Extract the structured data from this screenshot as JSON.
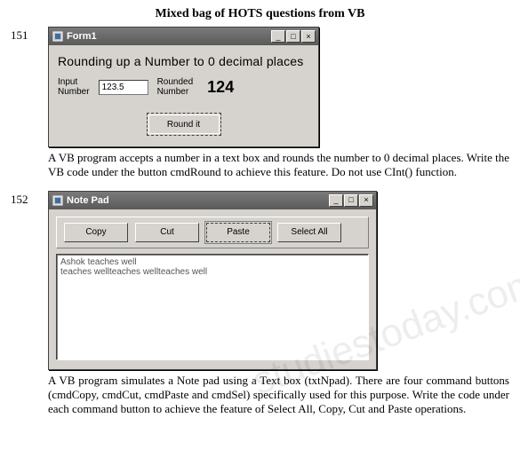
{
  "page_title": "Mixed bag of HOTS questions from VB",
  "watermark": "studiestoday.com",
  "q151": {
    "number": "151",
    "window_title": "Form1",
    "heading": "Rounding up  a Number to 0 decimal places",
    "input_label": "Input\nNumber",
    "input_value": "123.5",
    "rounded_label": "Rounded\nNumber",
    "rounded_value": "124",
    "round_button": "Round it",
    "description": "A VB program accepts a number in a text box and rounds the number to 0 decimal places. Write the VB code under the button cmdRound to achieve this feature. Do not use CInt() function."
  },
  "q152": {
    "number": "152",
    "window_title": "Note Pad",
    "buttons": {
      "copy": "Copy",
      "cut": "Cut",
      "paste": "Paste",
      "select_all": "Select All"
    },
    "textarea": "Ashok teaches well\nteaches wellteaches wellteaches well",
    "description": "A VB program simulates a Note pad using a Text box (txtNpad). There are four command buttons (cmdCopy, cmdCut, cmdPaste and cmdSel) specifically used for this purpose. Write the code under each command button to achieve the feature of Select All, Copy, Cut and Paste operations."
  },
  "win_controls": {
    "min": "_",
    "max": "□",
    "close": "×"
  }
}
